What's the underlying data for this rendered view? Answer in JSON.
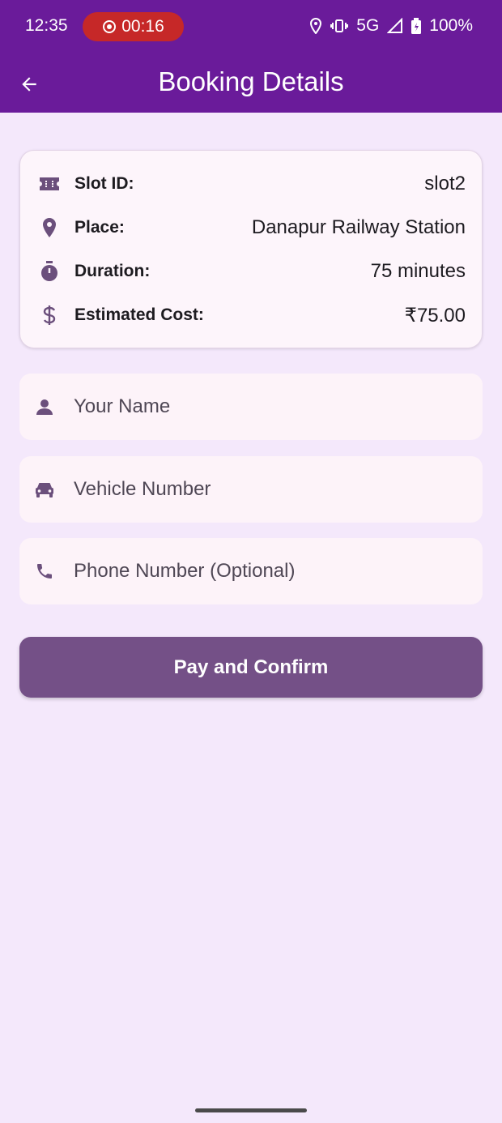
{
  "status_bar": {
    "time": "12:35",
    "recording_timer": "00:16",
    "network": "5G",
    "battery": "100%",
    "icons": [
      "location-icon",
      "vibrate-icon",
      "signal-icon",
      "battery-icon"
    ]
  },
  "app_bar": {
    "title": "Booking Details",
    "back_icon": "arrow-left-icon",
    "color": "#6a1b9a"
  },
  "booking": {
    "rows": [
      {
        "icon": "ticket-icon",
        "label": "Slot ID:",
        "value": "slot2"
      },
      {
        "icon": "location-pin-icon",
        "label": "Place:",
        "value": "Danapur Railway Station"
      },
      {
        "icon": "timer-icon",
        "label": "Duration:",
        "value": "75 minutes"
      },
      {
        "icon": "dollar-icon",
        "label": "Estimated Cost:",
        "value": "₹75.00"
      }
    ]
  },
  "form": {
    "name_placeholder": "Your Name",
    "vehicle_placeholder": "Vehicle Number",
    "phone_placeholder": "Phone Number (Optional)"
  },
  "actions": {
    "pay_label": "Pay and Confirm",
    "color": "#745087"
  },
  "colors": {
    "background": "#f4e8fb",
    "icon": "#6b4f7c"
  }
}
